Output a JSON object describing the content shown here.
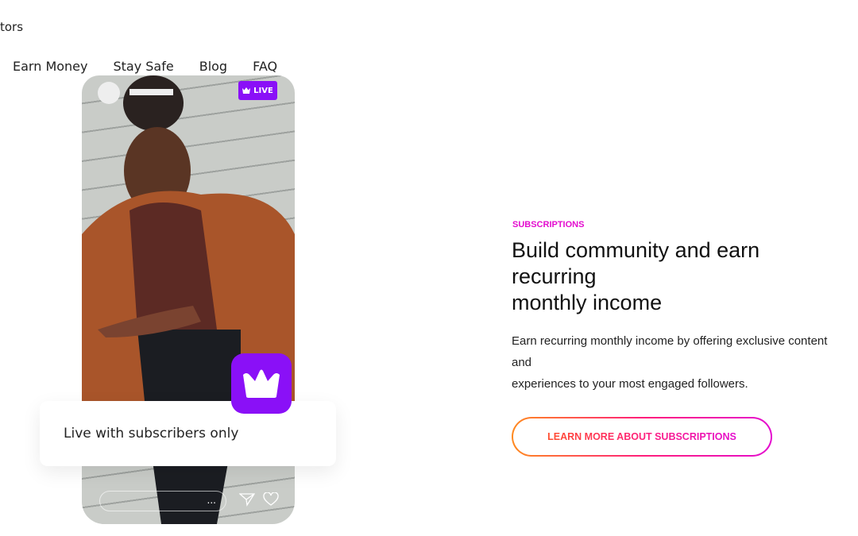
{
  "header": {
    "brand_fragment": "tors",
    "nav": [
      "Earn Money",
      "Stay Safe",
      "Blog",
      "FAQ"
    ]
  },
  "phone": {
    "live_badge": "LIVE",
    "comment_more": "...",
    "card_text": "Live with subscribers only"
  },
  "section": {
    "eyebrow": "SUBSCRIPTIONS",
    "title_line1": "Build community and earn recurring",
    "title_line2": "monthly income",
    "description_line1": "Earn recurring monthly income by offering exclusive content and",
    "description_line2": "experiences to your most engaged followers.",
    "cta": "LEARN MORE ABOUT SUBSCRIPTIONS"
  },
  "colors": {
    "accent_purple": "#8a10f7",
    "accent_pink": "#e40ccf",
    "accent_orange": "#ff8a1f"
  }
}
